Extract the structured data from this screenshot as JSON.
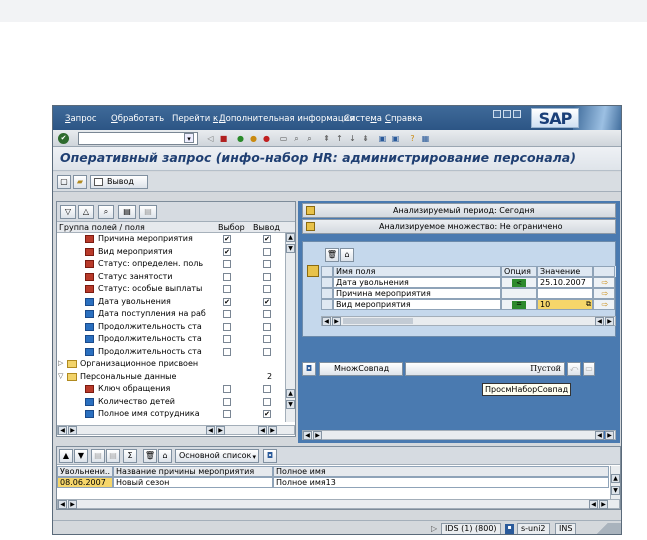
{
  "menu": [
    {
      "pre": "",
      "u": "З",
      "post": "апрос"
    },
    {
      "pre": "",
      "u": "О",
      "post": "бработать"
    },
    {
      "pre": "Перейти ",
      "u": "к",
      "post": ""
    },
    {
      "pre": "",
      "u": "Д",
      "post": "ополнительная информация"
    },
    {
      "pre": "Систе",
      "u": "м",
      "post": "а"
    },
    {
      "pre": "",
      "u": "С",
      "post": "правка"
    }
  ],
  "logo": "SAP",
  "page_title": "Оперативный запрос (инфо-набор HR: администрирование персонала)",
  "app_toolbar": {
    "output_label": "Вывод"
  },
  "left_pane": {
    "headers": {
      "group": "Группа полей / поля",
      "select": "Выбор",
      "output": "Вывод"
    },
    "rows": [
      {
        "label": "Причина мероприятия",
        "sel": "✔",
        "out": "✔",
        "kind": "field-red"
      },
      {
        "label": "Вид мероприятия",
        "sel": "✔",
        "out": "",
        "kind": "field-red"
      },
      {
        "label": "Статус: определен. поль",
        "sel": "",
        "out": "",
        "kind": "field-red"
      },
      {
        "label": "Статус занятости",
        "sel": "",
        "out": "",
        "kind": "field-red"
      },
      {
        "label": "Статус: особые выплаты",
        "sel": "",
        "out": "",
        "kind": "field-red"
      },
      {
        "label": "Дата увольнения",
        "sel": "✔",
        "out": "✔",
        "kind": "field"
      },
      {
        "label": "Дата поступления на раб",
        "sel": "",
        "out": "",
        "kind": "field"
      },
      {
        "label": "Продолжительность ста",
        "sel": "",
        "out": "",
        "kind": "field"
      },
      {
        "label": "Продолжительность ста",
        "sel": "",
        "out": "",
        "kind": "field"
      },
      {
        "label": "Продолжительность ста",
        "sel": "",
        "out": "",
        "kind": "field"
      },
      {
        "label": "Организационное присвоен",
        "sel": "",
        "out": "",
        "kind": "folder"
      },
      {
        "label": "Персональные данные",
        "sel": "",
        "out": "2",
        "kind": "folder-open"
      },
      {
        "label": "Ключ обращения",
        "sel": "",
        "out": "",
        "kind": "field-red"
      },
      {
        "label": "Количество детей",
        "sel": "",
        "out": "",
        "kind": "field"
      },
      {
        "label": "Полное имя сотрудника",
        "sel": "",
        "out": "✔",
        "kind": "field"
      }
    ]
  },
  "right": {
    "period_label": "Анализируемый период: Сегодня",
    "set_label": "Анализируемое множество: Не ограничено",
    "grid_headers": {
      "field": "Имя поля",
      "option": "Опция",
      "value": "Значение"
    },
    "grid_rows": [
      {
        "field": "Дата увольнения",
        "value": "25.10.2007",
        "opt": "lt"
      },
      {
        "field": "Причина мероприятия",
        "value": "",
        "opt": ""
      },
      {
        "field": "Вид мероприятия",
        "value": "10",
        "opt": "eq"
      }
    ],
    "match_button": "МножСовпад",
    "empty_label": "Пустой",
    "tooltip": "ПросмНаборСовпад"
  },
  "bottom": {
    "layout_button": "Основной список",
    "headers": [
      "Увольнени..",
      "Название причины мероприятия",
      "Полное имя"
    ],
    "rows": [
      [
        "08.06.2007",
        "Новый сезон",
        "Полное имя13"
      ]
    ]
  },
  "status": {
    "system": "IDS (1) (800)",
    "server": "s-uni2",
    "mode": "INS"
  }
}
